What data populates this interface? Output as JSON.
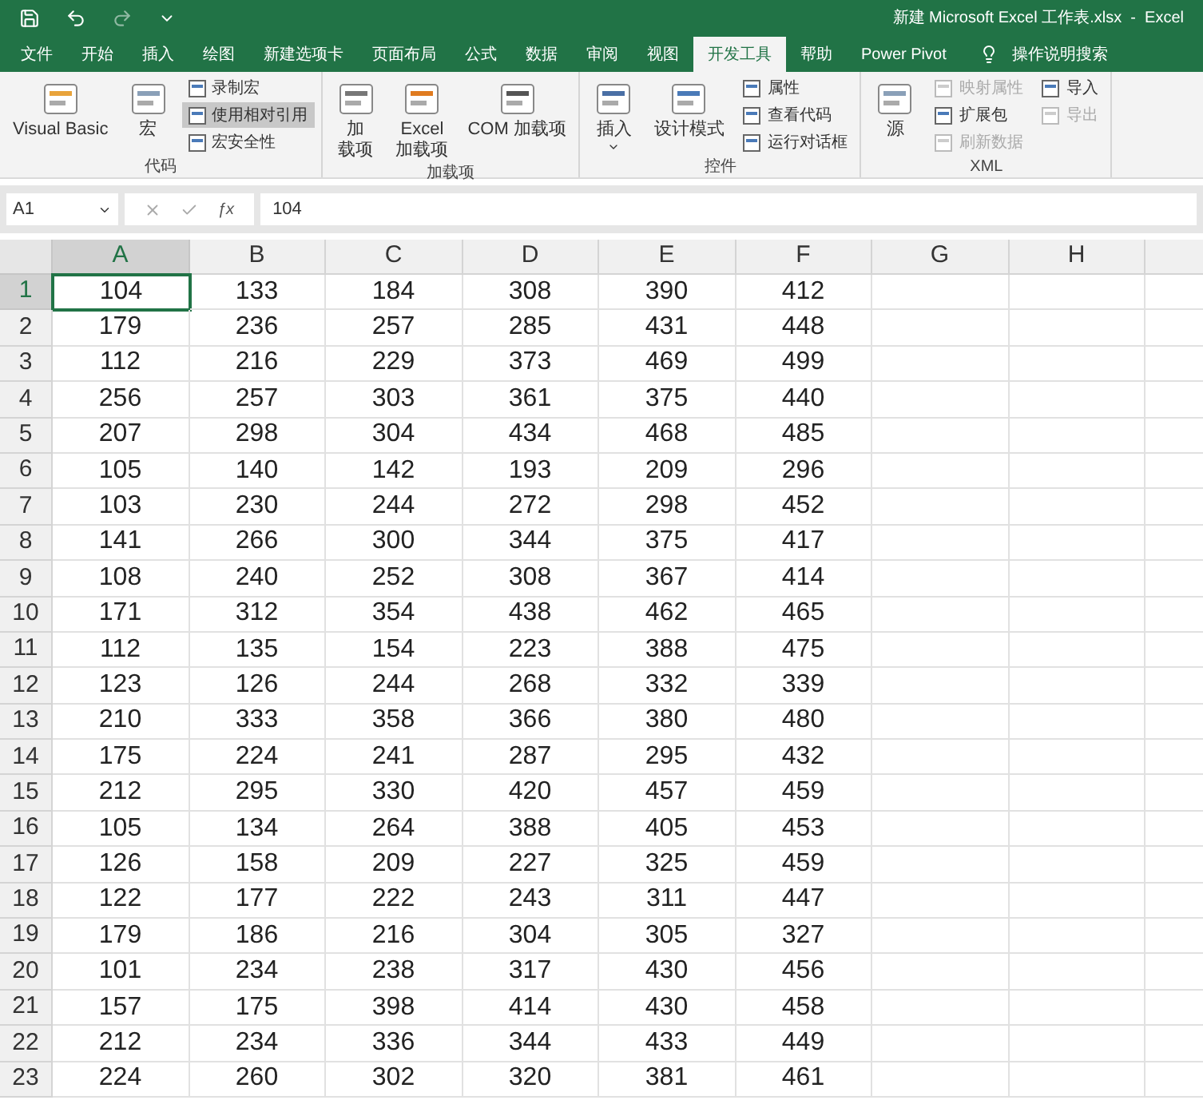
{
  "title_bar": {
    "title": "新建 Microsoft Excel 工作表.xlsx  -  Excel"
  },
  "tabs": [
    {
      "label": "文件",
      "selected": false
    },
    {
      "label": "开始",
      "selected": false
    },
    {
      "label": "插入",
      "selected": false
    },
    {
      "label": "绘图",
      "selected": false
    },
    {
      "label": "新建选项卡",
      "selected": false
    },
    {
      "label": "页面布局",
      "selected": false
    },
    {
      "label": "公式",
      "selected": false
    },
    {
      "label": "数据",
      "selected": false
    },
    {
      "label": "审阅",
      "selected": false
    },
    {
      "label": "视图",
      "selected": false
    },
    {
      "label": "开发工具",
      "selected": true
    },
    {
      "label": "帮助",
      "selected": false
    },
    {
      "label": "Power Pivot",
      "selected": false
    }
  ],
  "tell_me": "操作说明搜索",
  "ribbon": {
    "groups": [
      {
        "label": "代码",
        "items": [
          {
            "kind": "large",
            "lines": [
              "Visual Basic"
            ],
            "disabled": false
          },
          {
            "kind": "large",
            "lines": [
              "宏"
            ],
            "disabled": false
          },
          {
            "kind": "stack",
            "items": [
              {
                "label": "录制宏",
                "disabled": false,
                "selected": false
              },
              {
                "label": "使用相对引用",
                "disabled": false,
                "selected": true
              },
              {
                "label": "宏安全性",
                "disabled": false,
                "selected": false
              }
            ]
          }
        ]
      },
      {
        "label": "加载项",
        "items": [
          {
            "kind": "large",
            "lines": [
              "加",
              "载项"
            ],
            "disabled": false
          },
          {
            "kind": "large",
            "lines": [
              "Excel",
              "加载项"
            ],
            "disabled": false
          },
          {
            "kind": "large",
            "lines": [
              "COM 加载项"
            ],
            "disabled": false
          }
        ]
      },
      {
        "label": "控件",
        "items": [
          {
            "kind": "large",
            "lines": [
              "插入"
            ],
            "disabled": false,
            "dropdown": true
          },
          {
            "kind": "large",
            "lines": [
              "设计模式"
            ],
            "disabled": false
          },
          {
            "kind": "stack",
            "items": [
              {
                "label": "属性",
                "disabled": false,
                "selected": false
              },
              {
                "label": "查看代码",
                "disabled": false,
                "selected": false
              },
              {
                "label": "运行对话框",
                "disabled": false,
                "selected": false
              }
            ]
          }
        ]
      },
      {
        "label": "XML",
        "items": [
          {
            "kind": "large",
            "lines": [
              "源"
            ],
            "disabled": false
          },
          {
            "kind": "stack",
            "items": [
              {
                "label": "映射属性",
                "disabled": true,
                "selected": false
              },
              {
                "label": "扩展包",
                "disabled": false,
                "selected": false
              },
              {
                "label": "刷新数据",
                "disabled": true,
                "selected": false
              }
            ]
          },
          {
            "kind": "stack",
            "items": [
              {
                "label": "导入",
                "disabled": false,
                "selected": false
              },
              {
                "label": "导出",
                "disabled": true,
                "selected": false
              }
            ]
          }
        ]
      }
    ]
  },
  "formula_bar": {
    "name_box": "A1",
    "function_symbol": "ƒx",
    "value": "104"
  },
  "sheet": {
    "columns": [
      {
        "label": "A",
        "selected": true
      },
      {
        "label": "B",
        "selected": false
      },
      {
        "label": "C",
        "selected": false
      },
      {
        "label": "D",
        "selected": false
      },
      {
        "label": "E",
        "selected": false
      },
      {
        "label": "F",
        "selected": false
      },
      {
        "label": "G",
        "selected": false
      },
      {
        "label": "H",
        "selected": false
      }
    ],
    "rows": [
      {
        "header": "1",
        "selected": true,
        "cells": [
          "104",
          "133",
          "184",
          "308",
          "390",
          "412"
        ]
      },
      {
        "header": "2",
        "selected": false,
        "cells": [
          "179",
          "236",
          "257",
          "285",
          "431",
          "448"
        ]
      },
      {
        "header": "3",
        "selected": false,
        "cells": [
          "112",
          "216",
          "229",
          "373",
          "469",
          "499"
        ]
      },
      {
        "header": "4",
        "selected": false,
        "cells": [
          "256",
          "257",
          "303",
          "361",
          "375",
          "440"
        ]
      },
      {
        "header": "5",
        "selected": false,
        "cells": [
          "207",
          "298",
          "304",
          "434",
          "468",
          "485"
        ]
      },
      {
        "header": "6",
        "selected": false,
        "cells": [
          "105",
          "140",
          "142",
          "193",
          "209",
          "296"
        ]
      },
      {
        "header": "7",
        "selected": false,
        "cells": [
          "103",
          "230",
          "244",
          "272",
          "298",
          "452"
        ]
      },
      {
        "header": "8",
        "selected": false,
        "cells": [
          "141",
          "266",
          "300",
          "344",
          "375",
          "417"
        ]
      },
      {
        "header": "9",
        "selected": false,
        "cells": [
          "108",
          "240",
          "252",
          "308",
          "367",
          "414"
        ]
      },
      {
        "header": "10",
        "selected": false,
        "cells": [
          "171",
          "312",
          "354",
          "438",
          "462",
          "465"
        ]
      },
      {
        "header": "11",
        "selected": false,
        "cells": [
          "112",
          "135",
          "154",
          "223",
          "388",
          "475"
        ]
      },
      {
        "header": "12",
        "selected": false,
        "cells": [
          "123",
          "126",
          "244",
          "268",
          "332",
          "339"
        ]
      },
      {
        "header": "13",
        "selected": false,
        "cells": [
          "210",
          "333",
          "358",
          "366",
          "380",
          "480"
        ]
      },
      {
        "header": "14",
        "selected": false,
        "cells": [
          "175",
          "224",
          "241",
          "287",
          "295",
          "432"
        ]
      },
      {
        "header": "15",
        "selected": false,
        "cells": [
          "212",
          "295",
          "330",
          "420",
          "457",
          "459"
        ]
      },
      {
        "header": "16",
        "selected": false,
        "cells": [
          "105",
          "134",
          "264",
          "388",
          "405",
          "453"
        ]
      },
      {
        "header": "17",
        "selected": false,
        "cells": [
          "126",
          "158",
          "209",
          "227",
          "325",
          "459"
        ]
      },
      {
        "header": "18",
        "selected": false,
        "cells": [
          "122",
          "177",
          "222",
          "243",
          "311",
          "447"
        ]
      },
      {
        "header": "19",
        "selected": false,
        "cells": [
          "179",
          "186",
          "216",
          "304",
          "305",
          "327"
        ]
      },
      {
        "header": "20",
        "selected": false,
        "cells": [
          "101",
          "234",
          "238",
          "317",
          "430",
          "456"
        ]
      },
      {
        "header": "21",
        "selected": false,
        "cells": [
          "157",
          "175",
          "398",
          "414",
          "430",
          "458"
        ]
      },
      {
        "header": "22",
        "selected": false,
        "cells": [
          "212",
          "234",
          "336",
          "344",
          "433",
          "449"
        ]
      },
      {
        "header": "23",
        "selected": false,
        "cells": [
          "224",
          "260",
          "302",
          "320",
          "381",
          "461"
        ]
      }
    ]
  }
}
